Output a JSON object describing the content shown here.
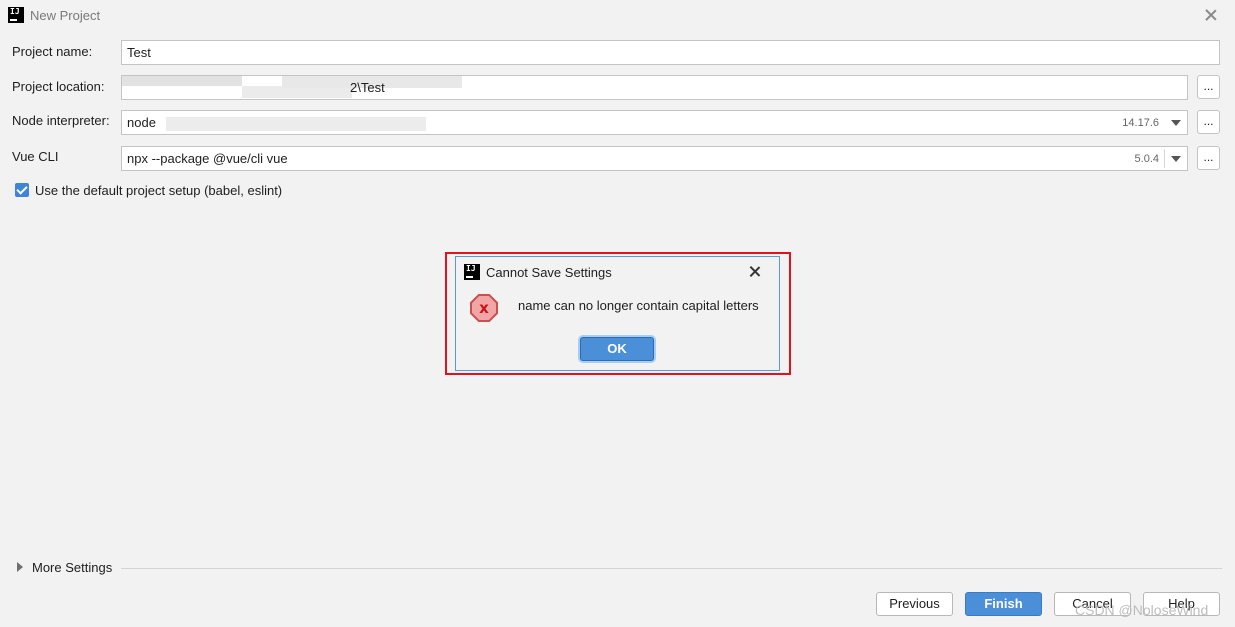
{
  "window": {
    "title": "New Project"
  },
  "form": {
    "project_name": {
      "label": "Project name:",
      "value": "Test"
    },
    "project_location": {
      "label": "Project location:",
      "value": "2\\Test",
      "browse": "..."
    },
    "node_interpreter": {
      "label": "Node interpreter:",
      "value": "node",
      "version": "14.17.6",
      "browse": "..."
    },
    "vue_cli": {
      "label": "Vue CLI",
      "value": "npx --package @vue/cli vue",
      "version": "5.0.4",
      "browse": "..."
    },
    "default_setup": {
      "label": "Use the default project setup (babel, eslint)",
      "checked": true
    }
  },
  "more_settings": {
    "label": "More Settings"
  },
  "buttons": {
    "previous": "Previous",
    "finish": "Finish",
    "cancel": "Cancel",
    "help": "Help"
  },
  "dialog": {
    "title": "Cannot Save Settings",
    "message": "name can no longer contain capital letters",
    "icon": "error-icon",
    "ok": "OK"
  },
  "watermark": "CSDN @NoloseWind",
  "colors": {
    "accent": "#4a8fd8",
    "highlight": "#e3101e",
    "error": "#c8151b"
  }
}
